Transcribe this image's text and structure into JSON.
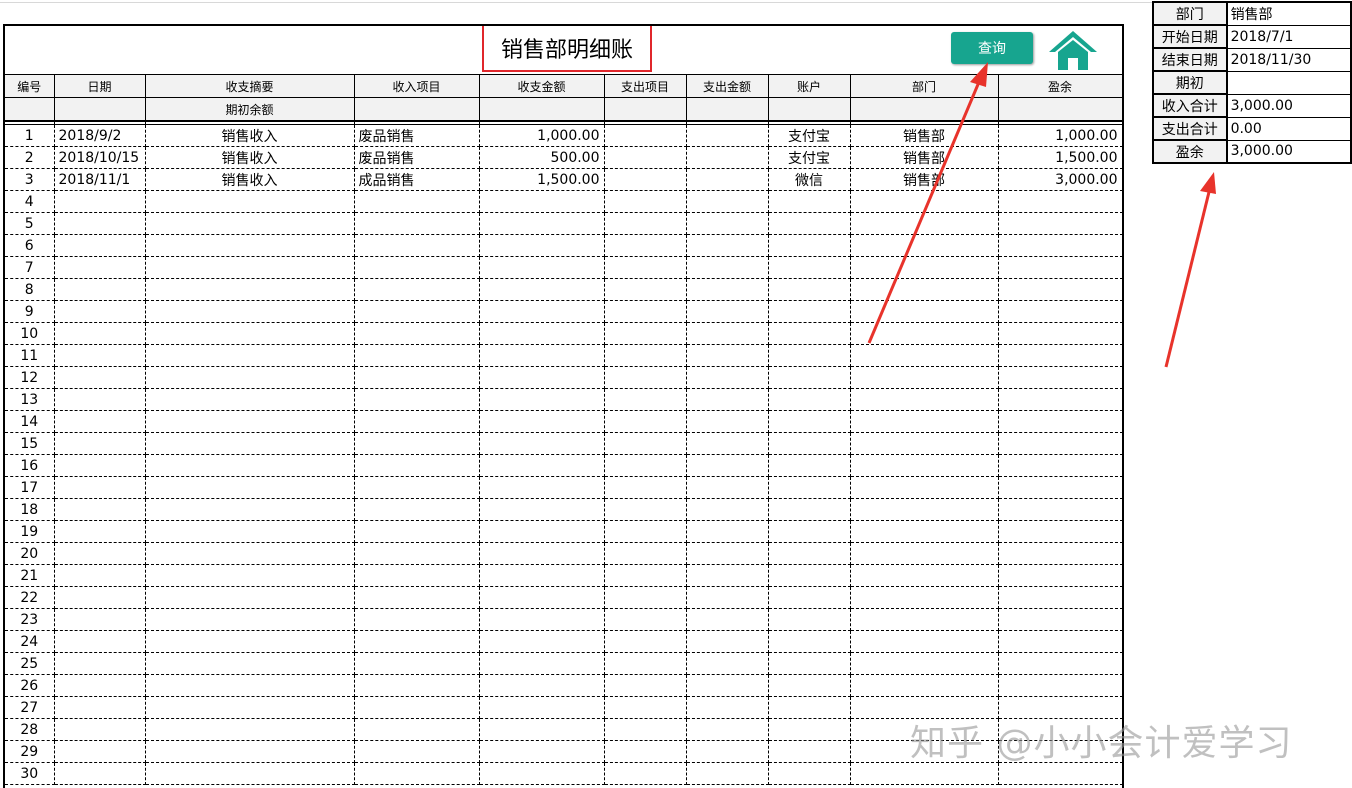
{
  "ledger": {
    "title": "销售部明细账",
    "query_button": "查询",
    "columns": [
      "编号",
      "日期",
      "收支摘要",
      "收入项目",
      "收支金额",
      "支出项目",
      "支出金额",
      "账户",
      "部门",
      "盈余"
    ],
    "opening_label": "期初余额",
    "rows": [
      {
        "no": "1",
        "date": "2018/9/2",
        "summary": "销售收入",
        "income_item": "废品销售",
        "amount": "1,000.00",
        "exp_item": "",
        "exp_amount": "",
        "account": "支付宝",
        "dept": "销售部",
        "balance": "1,000.00"
      },
      {
        "no": "2",
        "date": "2018/10/15",
        "summary": "销售收入",
        "income_item": "废品销售",
        "amount": "500.00",
        "exp_item": "",
        "exp_amount": "",
        "account": "支付宝",
        "dept": "销售部",
        "balance": "1,500.00"
      },
      {
        "no": "3",
        "date": "2018/11/1",
        "summary": "销售收入",
        "income_item": "成品销售",
        "amount": "1,500.00",
        "exp_item": "",
        "exp_amount": "",
        "account": "微信",
        "dept": "销售部",
        "balance": "3,000.00"
      }
    ],
    "empty_row_numbers": [
      "4",
      "5",
      "6",
      "7",
      "8",
      "9",
      "10",
      "11",
      "12",
      "13",
      "14",
      "15",
      "16",
      "17",
      "18",
      "19",
      "20",
      "21",
      "22",
      "23",
      "24",
      "25",
      "26",
      "27",
      "28",
      "29",
      "30"
    ]
  },
  "summary": {
    "rows": [
      {
        "label": "部门",
        "value": "销售部"
      },
      {
        "label": "开始日期",
        "value": "2018/7/1"
      },
      {
        "label": "结束日期",
        "value": "2018/11/30"
      },
      {
        "label": "期初",
        "value": ""
      },
      {
        "label": "收入合计",
        "value": "3,000.00"
      },
      {
        "label": "支出合计",
        "value": "0.00"
      },
      {
        "label": "盈余",
        "value": "3,000.00"
      }
    ]
  },
  "watermark": "知乎 @小小会计爱学习",
  "colors": {
    "button": "#17a58f",
    "highlight": "#e0262b",
    "home_icon": "#17a58f",
    "arrow": "#e8332b"
  }
}
